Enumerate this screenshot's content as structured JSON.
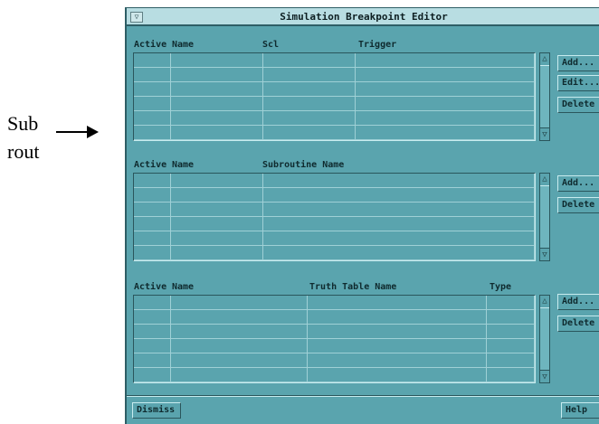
{
  "annotation": {
    "line1": "Sub",
    "line2": "rout"
  },
  "window": {
    "title": "Simulation Breakpoint Editor",
    "menu_glyph": "▽"
  },
  "scl_section": {
    "headers": [
      "Active",
      "Name",
      "Scl",
      "Trigger"
    ],
    "buttons": [
      "Add...",
      "Edit...",
      "Delete"
    ]
  },
  "subroutine_section": {
    "headers": [
      "Active",
      "Name",
      "Subroutine Name"
    ],
    "buttons": [
      "Add...",
      "Delete"
    ]
  },
  "truth_table_section": {
    "headers": [
      "Active",
      "Name",
      "Truth Table Name",
      "Type"
    ],
    "buttons": [
      "Add...",
      "Delete"
    ]
  },
  "footer": {
    "dismiss_label": "Dismiss",
    "help_label": "Help"
  },
  "scrollbar_glyphs": {
    "up": "△",
    "down": "▽"
  },
  "colors": {
    "window_bg": "#5aa4ae",
    "titlebar_bg": "#b8dde2",
    "grid_line": "#9fd0d6",
    "text": "#0f2a2e"
  }
}
